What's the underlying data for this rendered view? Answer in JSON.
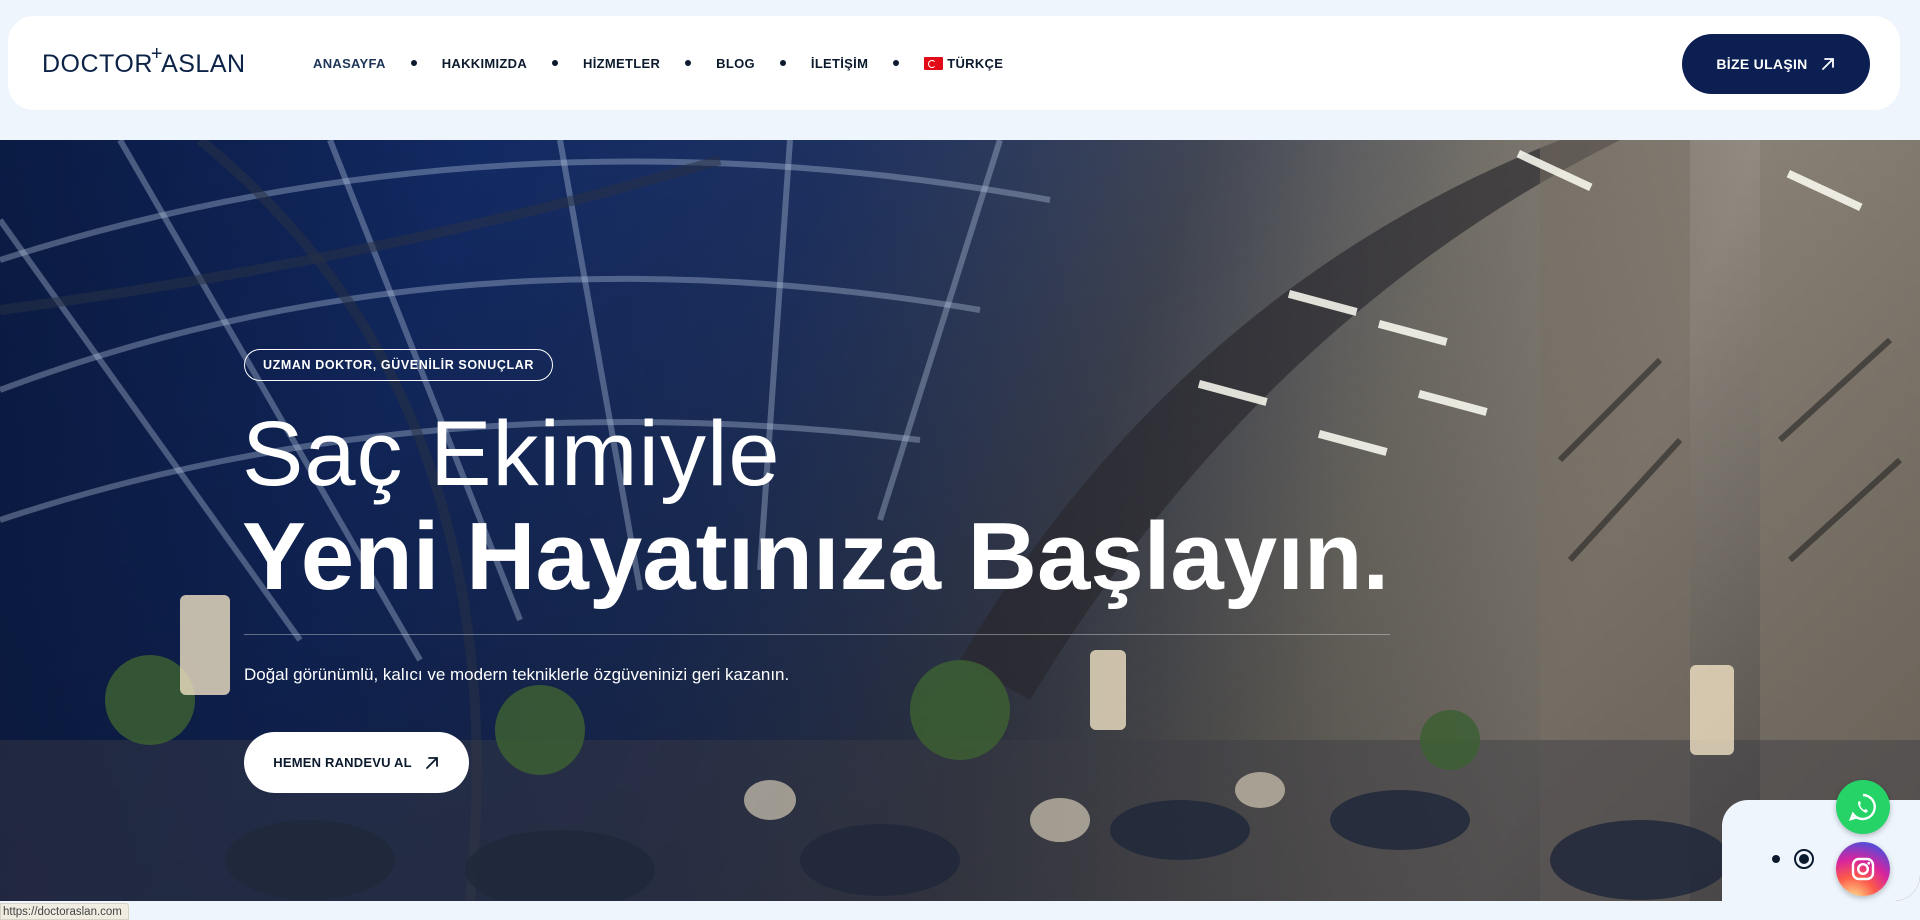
{
  "header": {
    "logo_left": "DOCTOR",
    "logo_right": "ASLAN",
    "nav": [
      {
        "label": "ANASAYFA"
      },
      {
        "label": "HAKKIMIZDA"
      },
      {
        "label": "HİZMETLER"
      },
      {
        "label": "BLOG"
      },
      {
        "label": "İLETİŞİM"
      },
      {
        "label": "TÜRKÇE"
      }
    ],
    "contact_label": "BİZE ULAŞIN"
  },
  "hero": {
    "badge": "UZMAN DOKTOR, GÜVENİLİR SONUÇLAR",
    "title_line1": "Saç Ekimiyle",
    "title_line2": "Yeni Hayatınıza Başlayın.",
    "subtitle": "Doğal görünümlü, kalıcı ve modern tekniklerle özgüveninizi geri kazanın.",
    "cta_label": "HEMEN RANDEVU AL"
  },
  "slider": {
    "slides": 2,
    "active_index": 1
  },
  "social": [
    "whatsapp-icon",
    "instagram-icon"
  ],
  "status_bar": {
    "url": "https://doctoraslan.com"
  },
  "colors": {
    "brand_navy": "#0b1f52",
    "page_bg": "#eef5fd",
    "whatsapp": "#25d366"
  }
}
